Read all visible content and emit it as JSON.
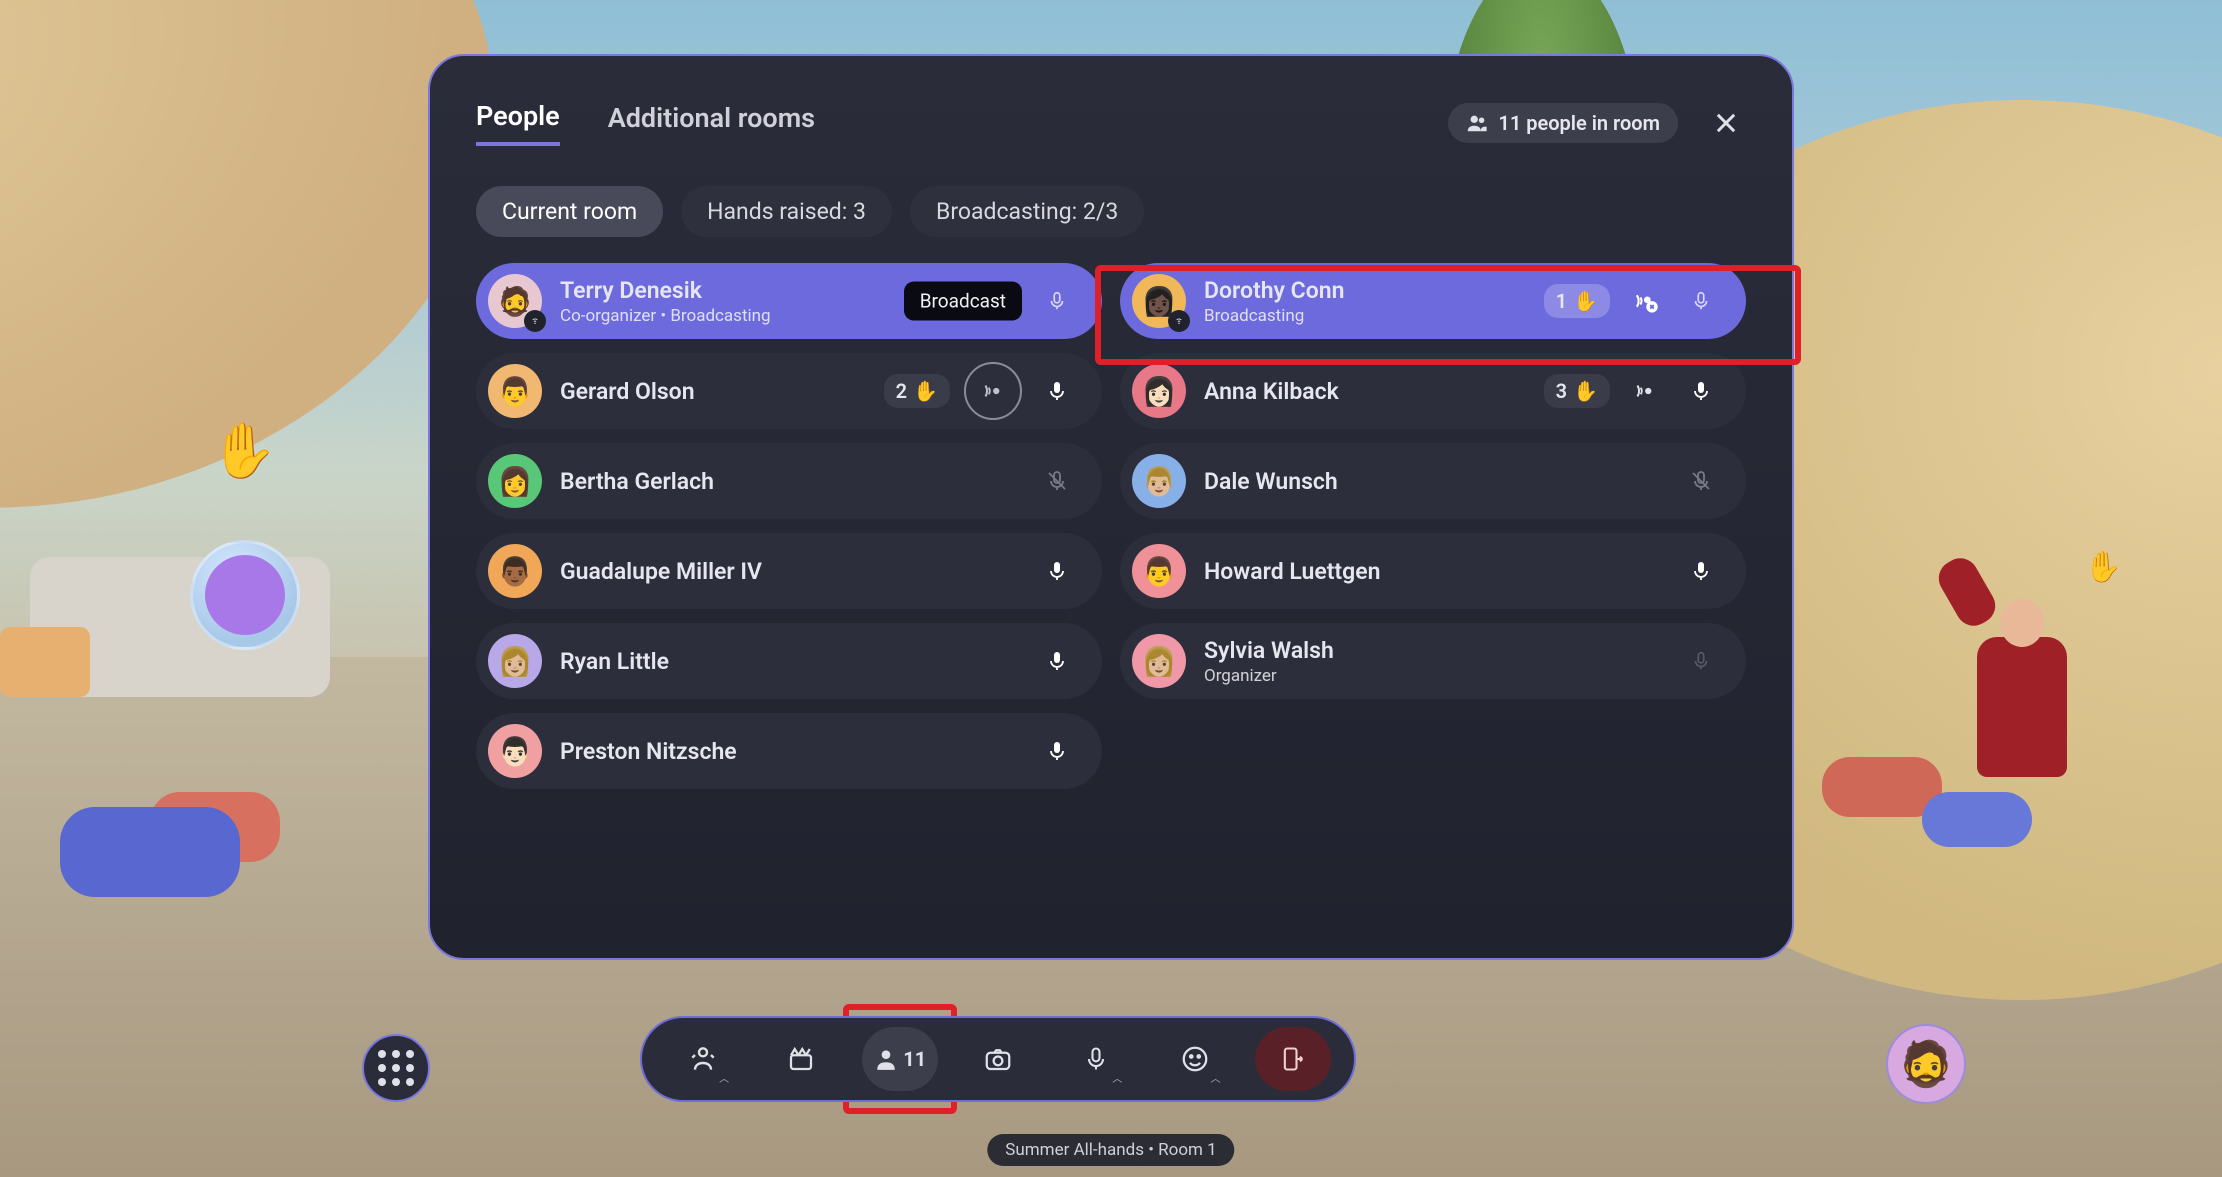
{
  "tabs": {
    "people": "People",
    "additional_rooms": "Additional rooms",
    "active": "people"
  },
  "header": {
    "people_count_label": "11 people in room"
  },
  "filters": {
    "current_room": "Current room",
    "hands_raised": "Hands raised: 3",
    "broadcasting": "Broadcasting: 2/3",
    "active": "current_room"
  },
  "tooltip": {
    "broadcast": "Broadcast"
  },
  "participants": {
    "left": [
      {
        "name": "Terry Denesik",
        "sub": "Co-organizer • Broadcasting",
        "highlight": true,
        "mic": "on-light",
        "avatar": "#e8c8d0",
        "emoji": "🧔",
        "badge": "host",
        "tooltip": true
      },
      {
        "name": "Gerard Olson",
        "hand": "2",
        "broadcast_btn": true,
        "mic": "on",
        "avatar": "#f0b870",
        "emoji": "👨"
      },
      {
        "name": "Bertha Gerlach",
        "mic": "muted",
        "avatar": "#58c878",
        "emoji": "👩"
      },
      {
        "name": "Guadalupe Miller IV",
        "mic": "on",
        "avatar": "#f0a858",
        "emoji": "👨🏾"
      },
      {
        "name": "Ryan Little",
        "mic": "on",
        "avatar": "#b8a8e8",
        "emoji": "👩🏼"
      },
      {
        "name": "Preston Nitzsche",
        "mic": "on",
        "avatar": "#f0a0a0",
        "emoji": "👨🏻"
      }
    ],
    "right": [
      {
        "name": "Dorothy Conn",
        "sub": "Broadcasting",
        "highlight": true,
        "hand": "1",
        "broadcast_stop": true,
        "mic": "on-light",
        "avatar": "#f0b858",
        "emoji": "👩🏿",
        "badge": "host"
      },
      {
        "name": "Anna Kilback",
        "hand": "3",
        "broadcast_icon": true,
        "mic": "on",
        "avatar": "#e87888",
        "emoji": "👩🏻"
      },
      {
        "name": "Dale Wunsch",
        "mic": "muted",
        "avatar": "#88b0e8",
        "emoji": "👨🏼"
      },
      {
        "name": "Howard Luettgen",
        "mic": "on",
        "avatar": "#f09098",
        "emoji": "👨"
      },
      {
        "name": "Sylvia Walsh",
        "sub": "Organizer",
        "mic": "off-dim",
        "avatar": "#f098a8",
        "emoji": "👩🏼"
      }
    ]
  },
  "dock": {
    "people_count": "11"
  },
  "room_label": "Summer All-hands • Room 1"
}
